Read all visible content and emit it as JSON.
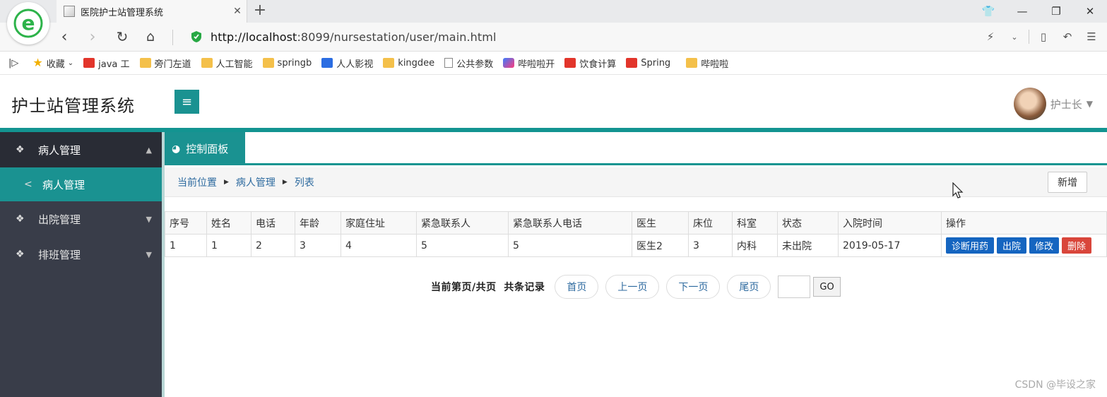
{
  "browser": {
    "tab_title": "医院护士站管理系统",
    "tab_close": "✕",
    "new_tab": "+",
    "url_host": "http://localhost",
    "url_rest": ":8099/nursestation/user/main.html",
    "bookmarks": [
      "收藏",
      "java 工",
      "旁门左道",
      "人工智能",
      "springb",
      "人人影视",
      "kingdee",
      "公共参数",
      "哔啦啦开",
      "饮食计算",
      "Spring",
      "哔啦啦"
    ]
  },
  "app": {
    "title": "护士站管理系统",
    "user_name": "护士长"
  },
  "sidebar": {
    "items": [
      {
        "label": "病人管理"
      },
      {
        "label": "病人管理"
      },
      {
        "label": "出院管理"
      },
      {
        "label": "排班管理"
      }
    ]
  },
  "main": {
    "tab_label": "控制面板",
    "breadcrumb": [
      "当前位置",
      "病人管理",
      "列表"
    ],
    "add_label": "新增",
    "columns": [
      "序号",
      "姓名",
      "电话",
      "年龄",
      "家庭住址",
      "紧急联系人",
      "紧急联系人电话",
      "医生",
      "床位",
      "科室",
      "状态",
      "入院时间",
      "操作"
    ],
    "rows": [
      {
        "cells": [
          "1",
          "1",
          "2",
          "3",
          "4",
          "5",
          "5",
          "医生2",
          "3",
          "内科",
          "未出院",
          "2019-05-17"
        ]
      }
    ],
    "row_actions": [
      "诊断用药",
      "出院",
      "修改",
      "删除"
    ],
    "pager": {
      "info": "当前第页/共页  共条记录",
      "first": "首页",
      "prev": "上一页",
      "next": "下一页",
      "last": "尾页",
      "go": "GO"
    }
  },
  "watermark": "CSDN @毕设之家",
  "colors": {
    "teal": "#1a9291",
    "sidebar": "#393d49",
    "action_blue": "#1565c0",
    "action_red": "#d9463b"
  }
}
